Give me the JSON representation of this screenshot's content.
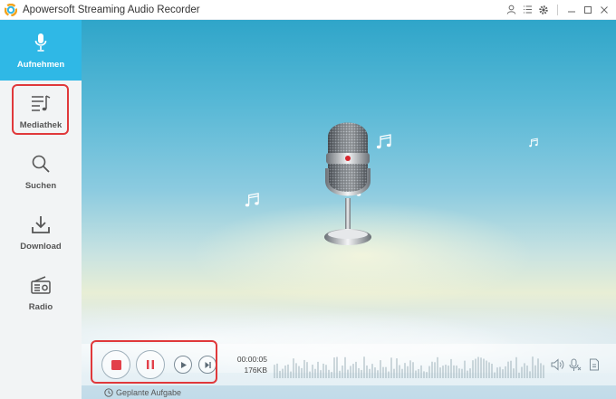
{
  "app": {
    "title": "Apowersoft Streaming Audio Recorder"
  },
  "titlebar": {
    "icons": [
      "user-icon",
      "list-icon",
      "gear-icon",
      "minimize-icon",
      "maximize-icon",
      "close-icon"
    ]
  },
  "sidebar": {
    "items": [
      {
        "label": "Aufnehmen",
        "icon": "microphone-icon",
        "active": true
      },
      {
        "label": "Mediathek",
        "icon": "music-list-icon",
        "active": false
      },
      {
        "label": "Suchen",
        "icon": "search-icon",
        "active": false
      },
      {
        "label": "Download",
        "icon": "download-icon",
        "active": false
      },
      {
        "label": "Radio",
        "icon": "radio-icon",
        "active": false
      }
    ]
  },
  "player": {
    "elapsed": "00:00:05",
    "size": "176KB",
    "controls": [
      "stop-icon",
      "pause-icon",
      "play-icon",
      "skip-next-icon"
    ]
  },
  "schedule": {
    "label": "Geplante Aufgabe"
  },
  "colors": {
    "accent": "#2fb8e6",
    "highlight": "#e0393b",
    "stop": "#e2404a"
  }
}
